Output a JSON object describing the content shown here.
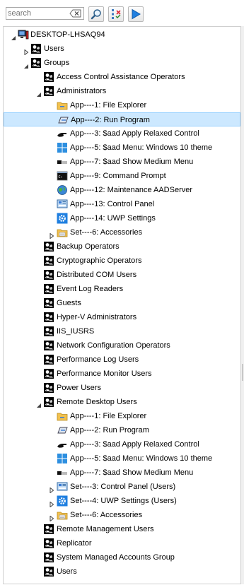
{
  "search": {
    "placeholder": "search"
  },
  "toolbar": {
    "find_icon": "magnify-icon",
    "filter_icon": "filter-icon",
    "run_icon": "play-icon"
  },
  "tree": [
    {
      "label": "DESKTOP-LHSAQ94",
      "icon": "computer",
      "level": 0,
      "toggle": "expanded"
    },
    {
      "label": "Users",
      "icon": "users",
      "level": 1,
      "toggle": "collapsed"
    },
    {
      "label": "Groups",
      "icon": "users",
      "level": 1,
      "toggle": "expanded"
    },
    {
      "label": "Access Control Assistance Operators",
      "icon": "users",
      "level": 2,
      "toggle": "none"
    },
    {
      "label": "Administrators",
      "icon": "users",
      "level": 2,
      "toggle": "expanded"
    },
    {
      "label": "App----1: File Explorer",
      "icon": "folder",
      "level": 3,
      "toggle": "none"
    },
    {
      "label": "App----2: Run Program",
      "icon": "run",
      "level": 3,
      "toggle": "none",
      "selected": true
    },
    {
      "label": "App----3: $aad Apply Relaxed Control",
      "icon": "hand",
      "level": 3,
      "toggle": "none"
    },
    {
      "label": "App----5: $aad Menu: Windows 10 theme",
      "icon": "windows",
      "level": 3,
      "toggle": "none"
    },
    {
      "label": "App----7: $aad Show Medium Menu",
      "icon": "menu",
      "level": 3,
      "toggle": "none"
    },
    {
      "label": "App----9: Command Prompt",
      "icon": "cmd",
      "level": 3,
      "toggle": "none"
    },
    {
      "label": "App----12: Maintenance AADServer",
      "icon": "globe",
      "level": 3,
      "toggle": "none"
    },
    {
      "label": "App----13: Control Panel",
      "icon": "cpanel",
      "level": 3,
      "toggle": "none"
    },
    {
      "label": "App----14: UWP Settings",
      "icon": "gear",
      "level": 3,
      "toggle": "none"
    },
    {
      "label": "Set----6: Accessories",
      "icon": "accessories",
      "level": 3,
      "toggle": "collapsed"
    },
    {
      "label": "Backup Operators",
      "icon": "users",
      "level": 2,
      "toggle": "none"
    },
    {
      "label": "Cryptographic Operators",
      "icon": "users",
      "level": 2,
      "toggle": "none"
    },
    {
      "label": "Distributed COM Users",
      "icon": "users",
      "level": 2,
      "toggle": "none"
    },
    {
      "label": "Event Log Readers",
      "icon": "users",
      "level": 2,
      "toggle": "none"
    },
    {
      "label": "Guests",
      "icon": "users",
      "level": 2,
      "toggle": "none"
    },
    {
      "label": "Hyper-V Administrators",
      "icon": "users",
      "level": 2,
      "toggle": "none"
    },
    {
      "label": "IIS_IUSRS",
      "icon": "users",
      "level": 2,
      "toggle": "none"
    },
    {
      "label": "Network Configuration Operators",
      "icon": "users",
      "level": 2,
      "toggle": "none"
    },
    {
      "label": "Performance Log Users",
      "icon": "users",
      "level": 2,
      "toggle": "none"
    },
    {
      "label": "Performance Monitor Users",
      "icon": "users",
      "level": 2,
      "toggle": "none"
    },
    {
      "label": "Power Users",
      "icon": "users",
      "level": 2,
      "toggle": "none"
    },
    {
      "label": "Remote Desktop Users",
      "icon": "users",
      "level": 2,
      "toggle": "expanded"
    },
    {
      "label": "App----1: File Explorer",
      "icon": "folder",
      "level": 3,
      "toggle": "none"
    },
    {
      "label": "App----2: Run Program",
      "icon": "run",
      "level": 3,
      "toggle": "none"
    },
    {
      "label": "App----3: $aad Apply Relaxed Control",
      "icon": "hand",
      "level": 3,
      "toggle": "none"
    },
    {
      "label": "App----5: $aad Menu: Windows 10 theme",
      "icon": "windows",
      "level": 3,
      "toggle": "none"
    },
    {
      "label": "App----7: $aad Show Medium Menu",
      "icon": "menu",
      "level": 3,
      "toggle": "none"
    },
    {
      "label": "Set----3: Control Panel (Users)",
      "icon": "cpanel",
      "level": 3,
      "toggle": "collapsed"
    },
    {
      "label": "Set----4: UWP Settings (Users)",
      "icon": "gear",
      "level": 3,
      "toggle": "collapsed"
    },
    {
      "label": "Set----6: Accessories",
      "icon": "accessories",
      "level": 3,
      "toggle": "collapsed"
    },
    {
      "label": "Remote Management Users",
      "icon": "users",
      "level": 2,
      "toggle": "none"
    },
    {
      "label": "Replicator",
      "icon": "users",
      "level": 2,
      "toggle": "none"
    },
    {
      "label": "System Managed Accounts Group",
      "icon": "users",
      "level": 2,
      "toggle": "none"
    },
    {
      "label": "Users",
      "icon": "users",
      "level": 2,
      "toggle": "none"
    }
  ],
  "colors": {
    "selection_bg": "#cce8ff",
    "selection_border": "#99d1ff"
  }
}
